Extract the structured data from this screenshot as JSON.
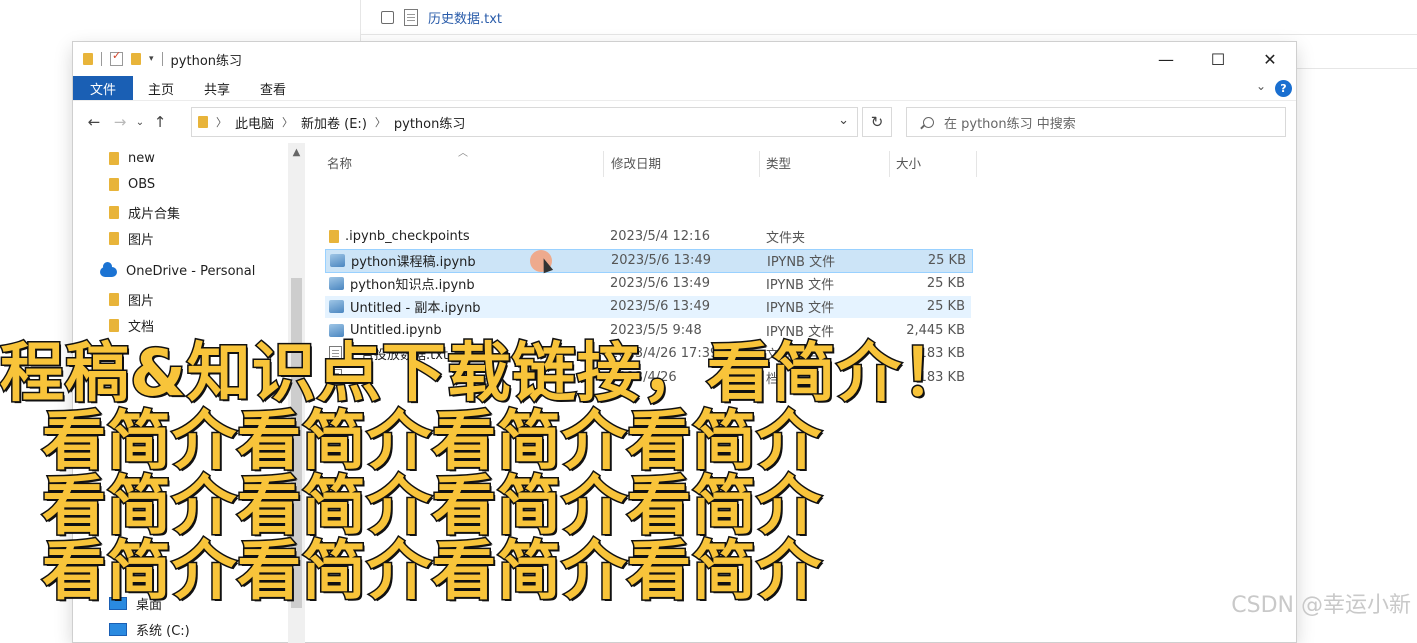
{
  "background_window": {
    "file_name": "历史数据.txt"
  },
  "window": {
    "title": "python练习",
    "controls": {
      "minimize": "—",
      "maximize": "☐",
      "close": "✕"
    }
  },
  "ribbon": {
    "tabs": [
      "文件",
      "主页",
      "共享",
      "查看"
    ],
    "help": "?"
  },
  "address": {
    "crumbs": [
      "此电脑",
      "新加卷 (E:)",
      "python练习"
    ],
    "search_placeholder": "在 python练习 中搜索"
  },
  "nav_pane": {
    "items": [
      {
        "label": "new",
        "icon": "folder-icon"
      },
      {
        "label": "OBS",
        "icon": "folder-icon"
      },
      {
        "label": "成片合集",
        "icon": "folder-icon"
      },
      {
        "label": "图片",
        "icon": "folder-icon"
      },
      {
        "label": "OneDrive - Personal",
        "icon": "onedrive-icon"
      },
      {
        "label": "图片",
        "icon": "folder-icon"
      },
      {
        "label": "文档",
        "icon": "folder-icon"
      }
    ],
    "desktop": "桌面",
    "system": "系统 (C:)"
  },
  "columns": {
    "name": "名称",
    "date": "修改日期",
    "type": "类型",
    "size": "大小"
  },
  "files": [
    {
      "name": ".ipynb_checkpoints",
      "date": "2023/5/4 12:16",
      "type": "文件夹",
      "size": "",
      "icon": "folder-icon",
      "state": ""
    },
    {
      "name": "python课程稿.ipynb",
      "date": "2023/5/6 13:49",
      "type": "IPYNB 文件",
      "size": "25 KB",
      "icon": "ipynb-icon",
      "state": "selected"
    },
    {
      "name": "python知识点.ipynb",
      "date": "2023/5/6 13:49",
      "type": "IPYNB 文件",
      "size": "25 KB",
      "icon": "ipynb-icon",
      "state": ""
    },
    {
      "name": "Untitled - 副本.ipynb",
      "date": "2023/5/6 13:49",
      "type": "IPYNB 文件",
      "size": "25 KB",
      "icon": "ipynb-icon",
      "state": "hover"
    },
    {
      "name": "Untitled.ipynb",
      "date": "2023/5/5 9:48",
      "type": "IPYNB 文件",
      "size": "2,445 KB",
      "icon": "ipynb-icon",
      "state": ""
    },
    {
      "name": "广告投放数据.txt",
      "date": "2023/4/26 17:39",
      "type": "文本文档",
      "size": "183 KB",
      "icon": "txt-icon",
      "state": ""
    },
    {
      "name": "",
      "date": "2023/4/26",
      "type": "档",
      "size": "183 KB",
      "icon": "txt-icon",
      "state": ""
    }
  ],
  "overlay": {
    "line1": "程稿&知识点下载链接，看简介！",
    "line2": "看简介看简介看简介看简介",
    "line3": "看简介看简介看简介看简介",
    "line4": "看简介看简介看简介看简介"
  },
  "watermark": "CSDN @幸运小新"
}
